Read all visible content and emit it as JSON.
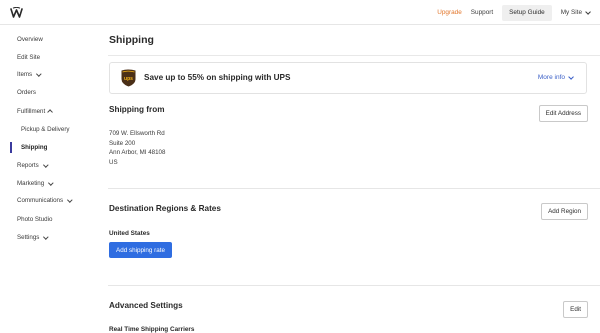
{
  "topbar": {
    "logo_icon": "weebly-w-logo-icon",
    "upgrade": "Upgrade",
    "support": "Support",
    "setup_guide": "Setup Guide",
    "my_site": "My Site",
    "upgrade_color": "#e2762b"
  },
  "sidebar": {
    "items": [
      {
        "label": "Overview"
      },
      {
        "label": "Edit Site"
      },
      {
        "label": "Items",
        "expandable": true
      },
      {
        "label": "Orders"
      },
      {
        "label": "Fulfillment",
        "expanded": true
      },
      {
        "label": "Pickup & Delivery"
      },
      {
        "label": "Shipping",
        "active": true
      },
      {
        "label": "Reports",
        "expandable": true
      },
      {
        "label": "Marketing",
        "expandable": true
      },
      {
        "label": "Communications",
        "expandable": true
      },
      {
        "label": "Photo Studio"
      },
      {
        "label": "Settings",
        "expandable": true
      }
    ]
  },
  "main": {
    "title": "Shipping",
    "ups_banner": {
      "icon": "ups-logo-icon",
      "text": "Save up to 55% on shipping with UPS",
      "more_info": "More info"
    },
    "shipping_from": {
      "title": "Shipping from",
      "edit_button": "Edit Address",
      "address_lines": [
        "709 W. Ellsworth Rd",
        "Suite 200",
        "Ann Arbor, MI 48108",
        "US"
      ]
    },
    "destinations": {
      "title": "Destination Regions & Rates",
      "add_button": "Add Region",
      "region": "United States",
      "add_rate_button": "Add shipping rate"
    },
    "advanced": {
      "title": "Advanced Settings",
      "edit_button": "Edit",
      "carriers_label": "Real Time Shipping Carriers"
    }
  },
  "colors": {
    "primary": "#2f6de1",
    "link": "#3a5fc7",
    "active_indicator": "#3b3b9e"
  }
}
